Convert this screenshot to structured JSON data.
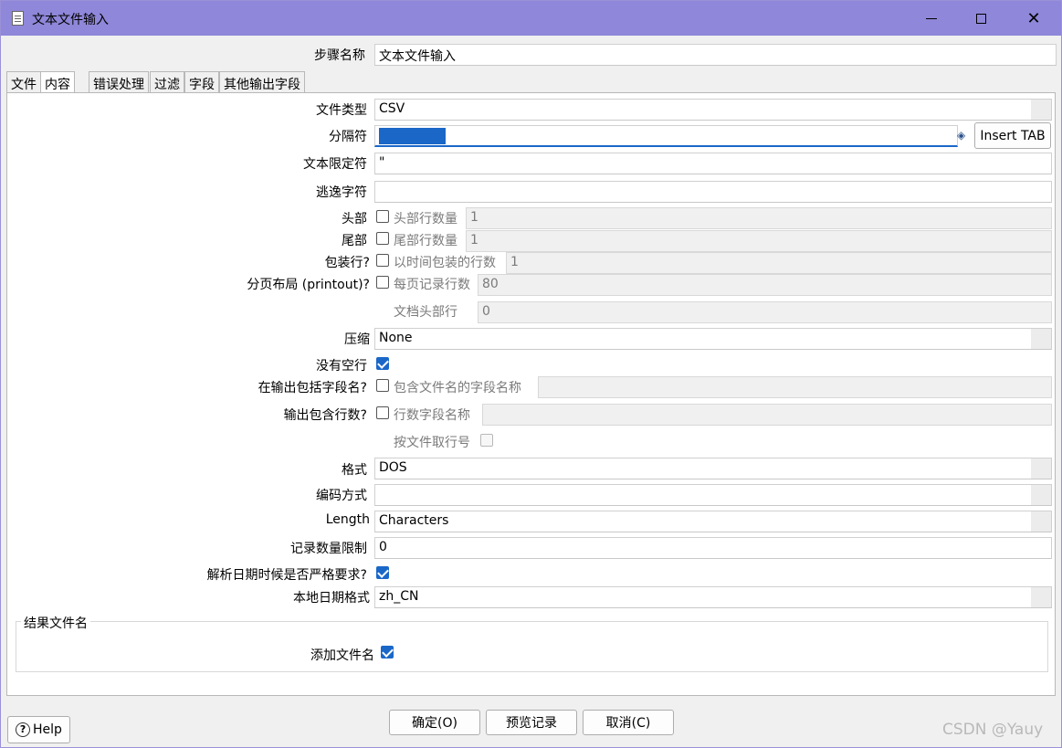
{
  "window": {
    "title": "文本文件输入",
    "icon": "document-icon"
  },
  "step": {
    "label": "步骤名称",
    "value": "文本文件输入"
  },
  "tabs": [
    "文件",
    "内容",
    "错误处理",
    "过滤",
    "字段",
    "其他输出字段"
  ],
  "active_tab": "内容",
  "content": {
    "file_type": {
      "label": "文件类型",
      "value": "CSV"
    },
    "separator": {
      "label": "分隔符",
      "value": "",
      "insert_tab": "Insert TAB"
    },
    "enclosure": {
      "label": "文本限定符",
      "value": "\""
    },
    "escape": {
      "label": "逃逸字符",
      "value": ""
    },
    "header": {
      "label": "头部",
      "checked": false,
      "sub_label": "头部行数量",
      "value": "1"
    },
    "footer": {
      "label": "尾部",
      "checked": false,
      "sub_label": "尾部行数量",
      "value": "1"
    },
    "wrap": {
      "label": "包装行?",
      "checked": false,
      "sub_label": "以时间包装的行数",
      "value": "1"
    },
    "paged": {
      "label": "分页布局 (printout)?",
      "checked": false,
      "sub_label": "每页记录行数",
      "value": "80"
    },
    "doc_header": {
      "label": "文档头部行",
      "value": "0"
    },
    "compression": {
      "label": "压缩",
      "value": "None"
    },
    "no_empty": {
      "label": "没有空行",
      "checked": true
    },
    "include_filename": {
      "label": "在输出包括字段名?",
      "checked": false,
      "sub_label": "包含文件名的字段名称",
      "value": ""
    },
    "include_rownum": {
      "label": "输出包含行数?",
      "checked": false,
      "sub_label": "行数字段名称",
      "value": ""
    },
    "rownum_by_file": {
      "label": "按文件取行号",
      "checked": false
    },
    "format": {
      "label": "格式",
      "value": "DOS"
    },
    "encoding": {
      "label": "编码方式",
      "value": ""
    },
    "length": {
      "label": "Length",
      "value": "Characters"
    },
    "limit": {
      "label": "记录数量限制",
      "value": "0"
    },
    "lenient_date": {
      "label": "解析日期时候是否严格要求?",
      "checked": true
    },
    "locale": {
      "label": "本地日期格式",
      "value": "zh_CN"
    },
    "result_group": {
      "title": "结果文件名",
      "add_label": "添加文件名",
      "checked": true
    }
  },
  "buttons": {
    "help": "Help",
    "ok": "确定(O)",
    "preview": "预览记录",
    "cancel": "取消(C)"
  },
  "watermark": "CSDN @Yauy",
  "colors": {
    "titlebar": "#8f87d9",
    "accent": "#1a67c8"
  }
}
